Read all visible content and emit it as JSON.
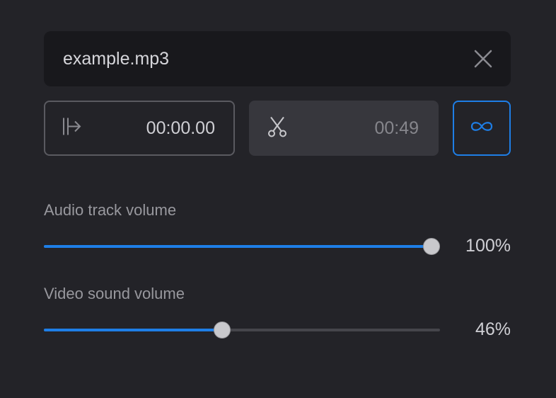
{
  "file": {
    "name": "example.mp3",
    "close_icon": "close-icon"
  },
  "trim": {
    "start_time": "00:00.00",
    "start_icon": "trim-start-icon",
    "duration": "00:49",
    "cut_icon": "scissors-icon",
    "loop_icon": "loop-infinity-icon",
    "loop_active": true
  },
  "audio_volume": {
    "label": "Audio track volume",
    "value_text": "100%",
    "value": 100
  },
  "video_volume": {
    "label": "Video sound volume",
    "value_text": "46%",
    "value": 46
  },
  "colors": {
    "accent": "#1e7ee6",
    "background": "#232328",
    "panel": "#18181c"
  }
}
